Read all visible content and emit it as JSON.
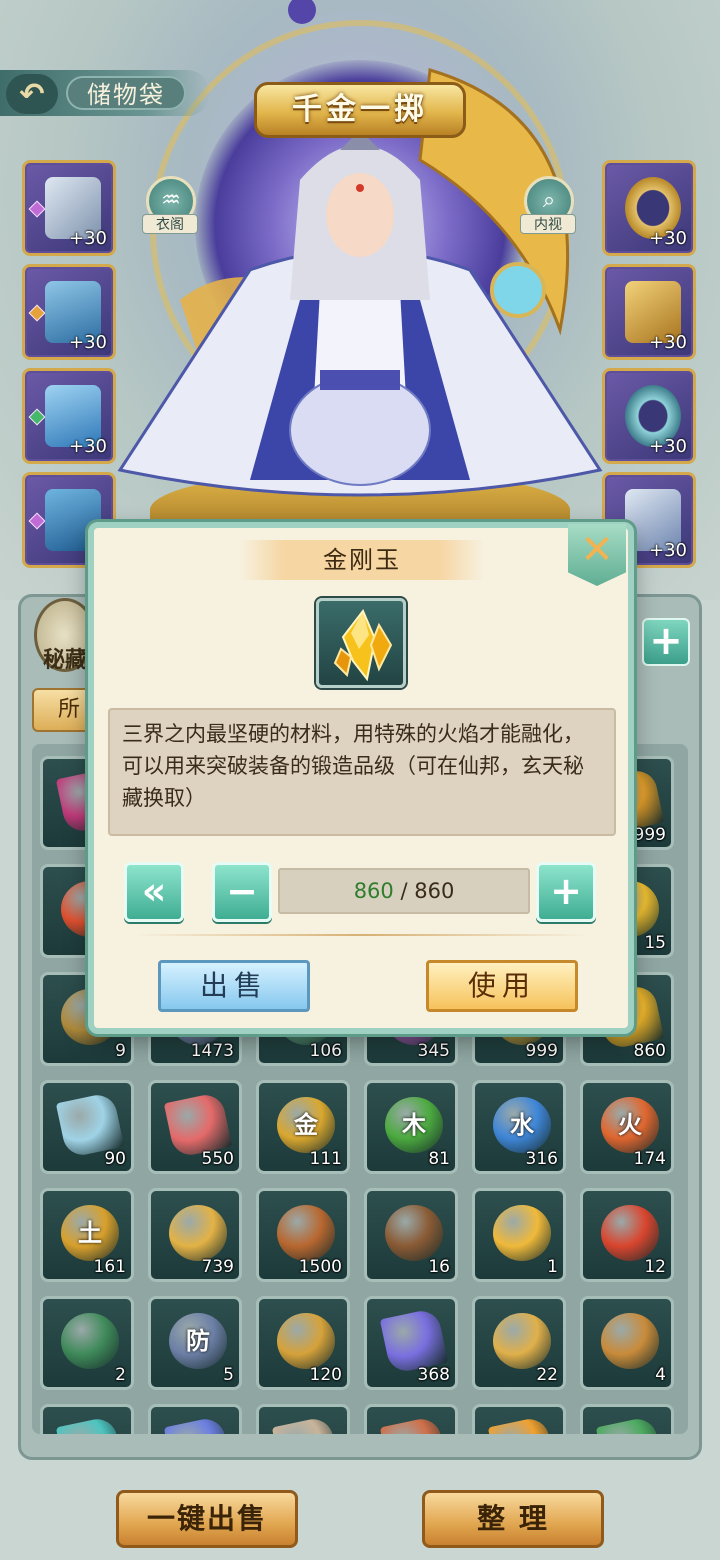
{
  "header": {
    "back_icon": "back-arrow-icon",
    "bag_title": "储物袋",
    "banner_title": "千金一掷",
    "wardrobe_label": "衣阁",
    "inspect_label": "内视"
  },
  "equipment": {
    "left": [
      {
        "icon": "sword-icon",
        "level": "+30"
      },
      {
        "icon": "helmet-icon",
        "level": "+30"
      },
      {
        "icon": "robe-icon",
        "level": "+30"
      },
      {
        "icon": "boots-icon",
        "level": ""
      }
    ],
    "right": [
      {
        "icon": "ring-icon",
        "level": "+30"
      },
      {
        "icon": "amulet-icon",
        "level": "+30"
      },
      {
        "icon": "bracelet-icon",
        "level": "+30"
      },
      {
        "icon": "pendant-icon",
        "level": "+30"
      }
    ]
  },
  "sidebar": {
    "secret_tab": "秘藏",
    "filter_tab": "所"
  },
  "dialog": {
    "title": "金刚玉",
    "close_icon": "close-x-icon",
    "item_icon": "gold-crystal-icon",
    "description": "三界之内最坚硬的材料，用特殊的火焰才能融化，可以用来突破装备的锻造品级（可在仙邦，玄天秘藏换取）",
    "max_icon": "double-chevron-left-icon",
    "minus_icon": "minus-icon",
    "plus_icon": "plus-icon",
    "quantity_current": "860",
    "quantity_separator": " / ",
    "quantity_max": "860",
    "sell_label": "出售",
    "use_label": "使用"
  },
  "inventory": {
    "row1_counts": [
      "",
      "",
      "",
      "",
      "",
      "9999"
    ],
    "row2_counts": [
      "",
      "",
      "",
      "",
      "",
      "15"
    ],
    "row3_counts": [
      "9",
      "1473",
      "106",
      "345",
      "999",
      "860"
    ],
    "row4": [
      {
        "kind": "crystal",
        "color": "#9fd3e6",
        "label": "",
        "count": "90"
      },
      {
        "kind": "crystal",
        "color": "#e56a6a",
        "label": "",
        "count": "550"
      },
      {
        "kind": "orb",
        "color": "#d9a72f",
        "label": "金",
        "count": "111"
      },
      {
        "kind": "orb",
        "color": "#4caa3f",
        "label": "木",
        "count": "81"
      },
      {
        "kind": "orb",
        "color": "#3f86d8",
        "label": "水",
        "count": "316"
      },
      {
        "kind": "orb",
        "color": "#e0662f",
        "label": "火",
        "count": "174"
      }
    ],
    "row5": [
      {
        "kind": "orb",
        "color": "#d8a02c",
        "label": "土",
        "count": "161"
      },
      {
        "kind": "orb",
        "color": "#e3b246",
        "label": "",
        "count": "739"
      },
      {
        "kind": "orb",
        "color": "#b8672f",
        "label": "",
        "count": "1500"
      },
      {
        "kind": "orb",
        "color": "#8a5a34",
        "label": "",
        "count": "16"
      },
      {
        "kind": "orb",
        "color": "#f0b93a",
        "label": "",
        "count": "1"
      },
      {
        "kind": "orb",
        "color": "#d9452e",
        "label": "",
        "count": "12"
      }
    ],
    "row6": [
      {
        "kind": "orb",
        "color": "#3f8a5a",
        "label": "",
        "count": "2"
      },
      {
        "kind": "orb",
        "color": "#6c7fa6",
        "label": "防",
        "count": "5"
      },
      {
        "kind": "orb",
        "color": "#d6a23a",
        "label": "",
        "count": "120"
      },
      {
        "kind": "crystal",
        "color": "#7a6fe0",
        "label": "",
        "count": "368"
      },
      {
        "kind": "orb",
        "color": "#e0b04a",
        "label": "",
        "count": "22"
      },
      {
        "kind": "orb",
        "color": "#c98b3a",
        "label": "",
        "count": "4"
      }
    ],
    "row7_colors": [
      "#4ec5c0",
      "#6c7fe0",
      "#c9b49a",
      "#d0704a",
      "#f0a030",
      "#4caa5f"
    ]
  },
  "footer": {
    "sell_all_label": "一键出售",
    "sort_label": "整 理"
  }
}
